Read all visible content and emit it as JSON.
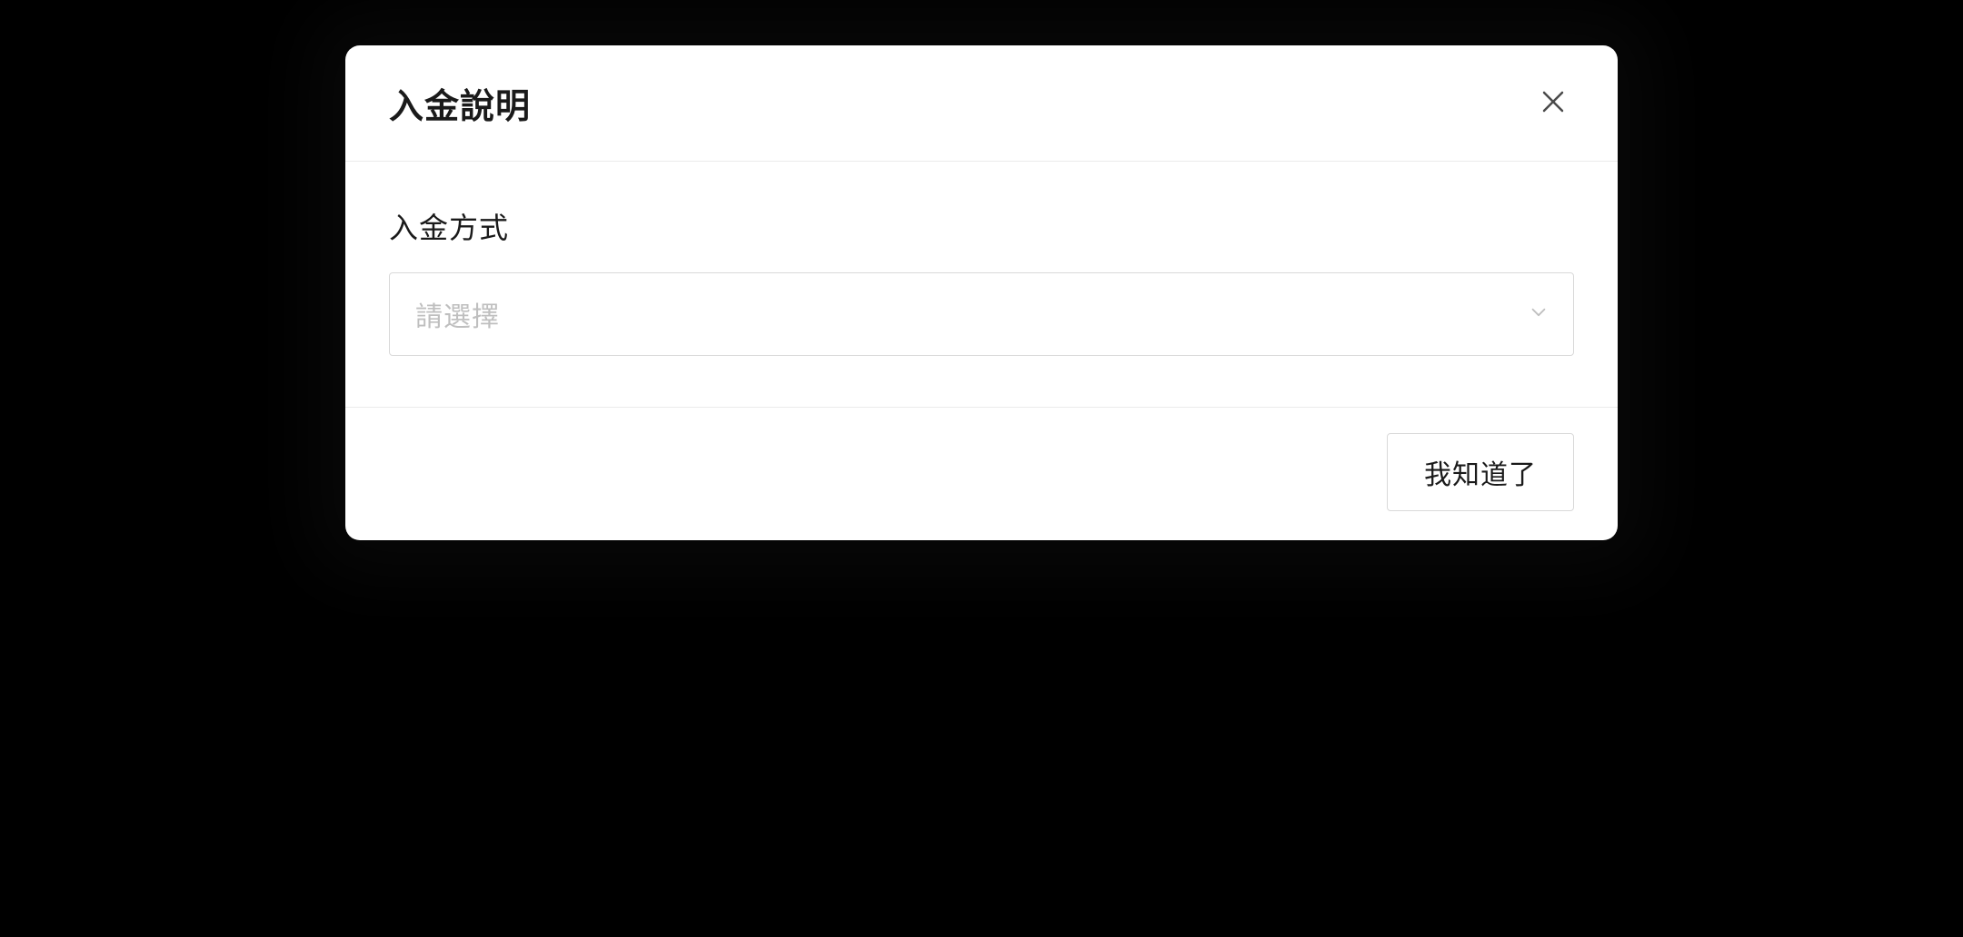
{
  "modal": {
    "title": "入金說明",
    "body": {
      "deposit_method_label": "入金方式",
      "deposit_method_placeholder": "請選擇"
    },
    "footer": {
      "confirm_label": "我知道了"
    }
  }
}
